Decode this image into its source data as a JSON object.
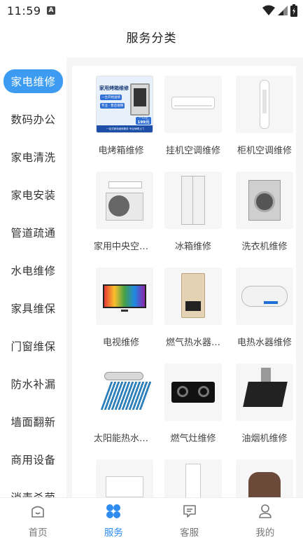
{
  "status": {
    "time": "11:59"
  },
  "header": {
    "title": "服务分类"
  },
  "sidebar": {
    "items": [
      {
        "label": "家电维修",
        "active": true
      },
      {
        "label": "数码办公"
      },
      {
        "label": "家电清洗"
      },
      {
        "label": "家电安装"
      },
      {
        "label": "管道疏通"
      },
      {
        "label": "水电维修"
      },
      {
        "label": "家具维保"
      },
      {
        "label": "门窗维保"
      },
      {
        "label": "防水补漏"
      },
      {
        "label": "墙面翻新"
      },
      {
        "label": "商用设备"
      },
      {
        "label": "消毒杀菌"
      }
    ]
  },
  "services": [
    {
      "label": "电烤箱维修",
      "icon": "oven-promo-image",
      "promo": {
        "title": "家用烤箱维修",
        "tag1": "一台开始送修",
        "tag2": "专业 · 售后保障",
        "price_top": "一口价",
        "price": "199元",
        "footer": "一站式家电维修服务 专业师傅上门"
      }
    },
    {
      "label": "挂机空调维修",
      "icon": "wall-ac-image"
    },
    {
      "label": "柜机空调维修",
      "icon": "tower-ac-image"
    },
    {
      "label": "家用中央空…",
      "icon": "central-ac-image"
    },
    {
      "label": "冰箱维修",
      "icon": "fridge-image"
    },
    {
      "label": "洗衣机维修",
      "icon": "washer-image"
    },
    {
      "label": "电视维修",
      "icon": "tv-image"
    },
    {
      "label": "燃气热水器…",
      "icon": "gas-heater-image"
    },
    {
      "label": "电热水器维修",
      "icon": "electric-heater-image"
    },
    {
      "label": "太阳能热水…",
      "icon": "solar-heater-image"
    },
    {
      "label": "燃气灶维修",
      "icon": "gas-stove-image"
    },
    {
      "label": "油烟机维修",
      "icon": "range-hood-image"
    },
    {
      "label": "",
      "icon": "microwave-image"
    },
    {
      "label": "",
      "icon": "water-dispenser-image"
    },
    {
      "label": "",
      "icon": "rice-cooker-image"
    }
  ],
  "tabbar": {
    "items": [
      {
        "label": "首页",
        "icon": "home-icon"
      },
      {
        "label": "服务",
        "icon": "service-grid-icon",
        "active": true
      },
      {
        "label": "客服",
        "icon": "chat-icon"
      },
      {
        "label": "我的",
        "icon": "user-icon"
      }
    ]
  },
  "colors": {
    "accent": "#3d9cf2",
    "tab_active": "#2f8cf0",
    "content_bg": "#f5f5f5"
  }
}
